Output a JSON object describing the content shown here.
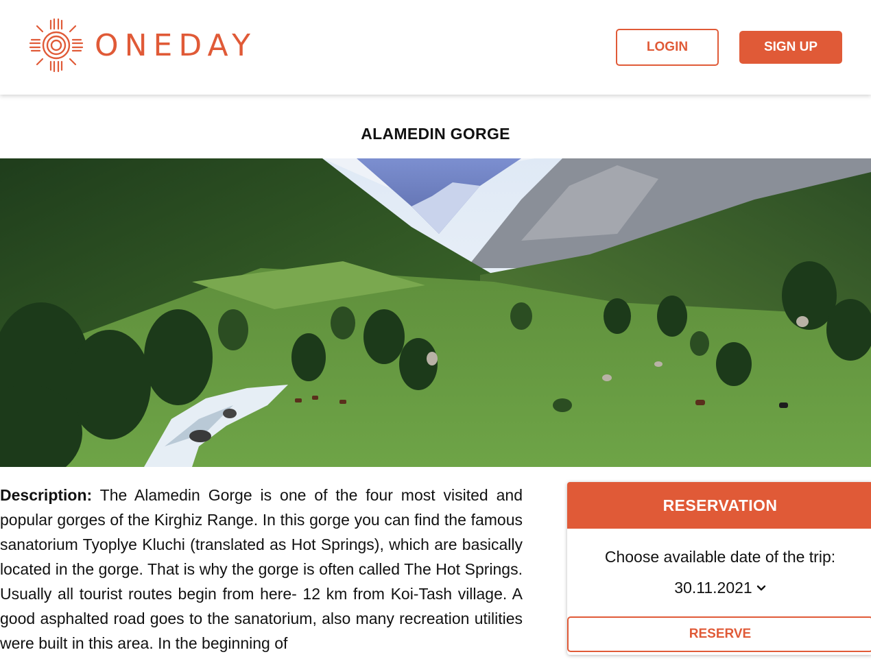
{
  "header": {
    "brand": "ONEDAY",
    "login_label": "LOGIN",
    "signup_label": "SIGN UP",
    "brand_color": "#e05a37"
  },
  "page": {
    "title": "ALAMEDIN GORGE"
  },
  "description": {
    "label": "Description:",
    "text": "The Alamedin Gorge is one of the four most visited and popular gorges of the Kirghiz Range. In this gorge you can find the famous sanatorium Tyoplye Kluchi (translated as Hot Springs), which are basically located in the gorge. That is why the gorge is often called The Hot Springs. Usually all tourist routes begin from here- 12 km from Koi-Tash village. A good asphalted road goes to the sanatorium, also many recreation utilities were built in this area. In the beginning of"
  },
  "reservation": {
    "title": "RESERVATION",
    "prompt": "Choose available date of the trip:",
    "selected_date": "30.11.2021",
    "reserve_label": "RESERVE"
  }
}
